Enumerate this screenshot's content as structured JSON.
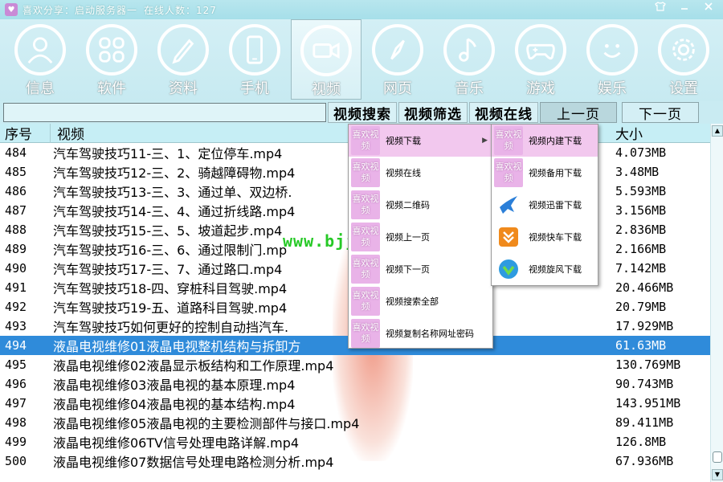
{
  "window": {
    "title": "喜欢分享：启动服务器一",
    "status_label": "在线人数：127",
    "logo": "heart-logo",
    "controls": [
      "shirt-icon",
      "minimize-icon",
      "close-icon"
    ]
  },
  "nav": {
    "items": [
      {
        "label": "信息",
        "icon": "person-icon"
      },
      {
        "label": "软件",
        "icon": "apps-icon"
      },
      {
        "label": "资料",
        "icon": "pencil-icon"
      },
      {
        "label": "手机",
        "icon": "phone-icon"
      },
      {
        "label": "视频",
        "icon": "video-camera-icon"
      },
      {
        "label": "网页",
        "icon": "compass-icon"
      },
      {
        "label": "音乐",
        "icon": "music-note-icon"
      },
      {
        "label": "游戏",
        "icon": "gamepad-icon"
      },
      {
        "label": "娱乐",
        "icon": "smiley-icon"
      },
      {
        "label": "设置",
        "icon": "gear-icon"
      }
    ],
    "active": "视频"
  },
  "subbar": {
    "search_value": "",
    "buttons": [
      "视频搜索",
      "视频筛选",
      "视频在线"
    ],
    "prev_label": "上一页",
    "next_label": "下一页"
  },
  "list": {
    "headers": {
      "seq": "序号",
      "name": "视频",
      "size": "大小"
    },
    "rows": [
      {
        "seq": "484",
        "name": "汽车驾驶技巧11-三、1、定位停车.mp4",
        "size": "4.073MB"
      },
      {
        "seq": "485",
        "name": "汽车驾驶技巧12-三、2、骑越障碍物.mp4",
        "size": "3.48MB"
      },
      {
        "seq": "486",
        "name": "汽车驾驶技巧13-三、3、通过单、双边桥.",
        "size": "5.593MB"
      },
      {
        "seq": "487",
        "name": "汽车驾驶技巧14-三、4、通过折线路.mp4",
        "size": "3.156MB"
      },
      {
        "seq": "488",
        "name": "汽车驾驶技巧15-三、5、坡道起步.mp4",
        "size": "2.836MB"
      },
      {
        "seq": "489",
        "name": "汽车驾驶技巧16-三、6、通过限制门.mp",
        "size": "2.166MB"
      },
      {
        "seq": "490",
        "name": "汽车驾驶技巧17-三、7、通过路口.mp4",
        "size": "7.142MB"
      },
      {
        "seq": "491",
        "name": "汽车驾驶技巧18-四、穿桩科目驾驶.mp4",
        "size": "20.466MB"
      },
      {
        "seq": "492",
        "name": "汽车驾驶技巧19-五、道路科目驾驶.mp4",
        "size": "20.79MB"
      },
      {
        "seq": "493",
        "name": "汽车驾驶技巧如何更好的控制自动挡汽车.",
        "size": "17.929MB"
      },
      {
        "seq": "494",
        "name": "液晶电视维修01液晶电视整机结构与拆卸方",
        "size": "61.63MB"
      },
      {
        "seq": "495",
        "name": "液晶电视维修02液晶显示板结构和工作原理.mp4",
        "size": "130.769MB"
      },
      {
        "seq": "496",
        "name": "液晶电视维修03液晶电视的基本原理.mp4",
        "size": "90.743MB"
      },
      {
        "seq": "497",
        "name": "液晶电视维修04液晶电视的基本结构.mp4",
        "size": "143.951MB"
      },
      {
        "seq": "498",
        "name": "液晶电视维修05液晶电视的主要检测部件与接口.mp4",
        "size": "89.411MB"
      },
      {
        "seq": "499",
        "name": "液晶电视维修06TV信号处理电路详解.mp4",
        "size": "126.8MB"
      },
      {
        "seq": "500",
        "name": "液晶电视维修07数据信号处理电路检测分析.mp4",
        "size": "67.936MB"
      }
    ],
    "selected_seq": "494",
    "watermark": "www.bjjdwx.com"
  },
  "context_menu": {
    "items": [
      {
        "label": "视频下载",
        "icon_text": "喜欢视频",
        "has_submenu": true
      },
      {
        "label": "视频在线",
        "icon_text": "喜欢视频"
      },
      {
        "label": "视频二维码",
        "icon_text": "喜欢视频"
      },
      {
        "label": "视频上一页",
        "icon_text": "喜欢视频"
      },
      {
        "label": "视频下一页",
        "icon_text": "喜欢视频"
      },
      {
        "label": "视频搜索全部",
        "icon_text": "喜欢视频"
      },
      {
        "label": "视频复制名称网址密码",
        "icon_text": "喜欢视频"
      }
    ]
  },
  "submenu": {
    "items": [
      {
        "label": "视频内建下载",
        "icon": "xihuan-icon",
        "icon_text": "喜欢视频"
      },
      {
        "label": "视频备用下载",
        "icon": "xihuan-icon",
        "icon_text": "喜欢视频"
      },
      {
        "label": "视频迅雷下载",
        "icon": "thunder-bird-icon",
        "icon_text": ""
      },
      {
        "label": "视频快车下载",
        "icon": "flashget-icon",
        "icon_text": ""
      },
      {
        "label": "视频旋风下载",
        "icon": "qq-whirlwind-icon",
        "icon_text": ""
      }
    ]
  },
  "colors": {
    "titlebar": "#a6dfe9",
    "toolbar": "#c9ebf2",
    "selection": "#2f8bda",
    "menu_hover": "#f2c8ee",
    "menu_icon": "#e9b3e8"
  }
}
